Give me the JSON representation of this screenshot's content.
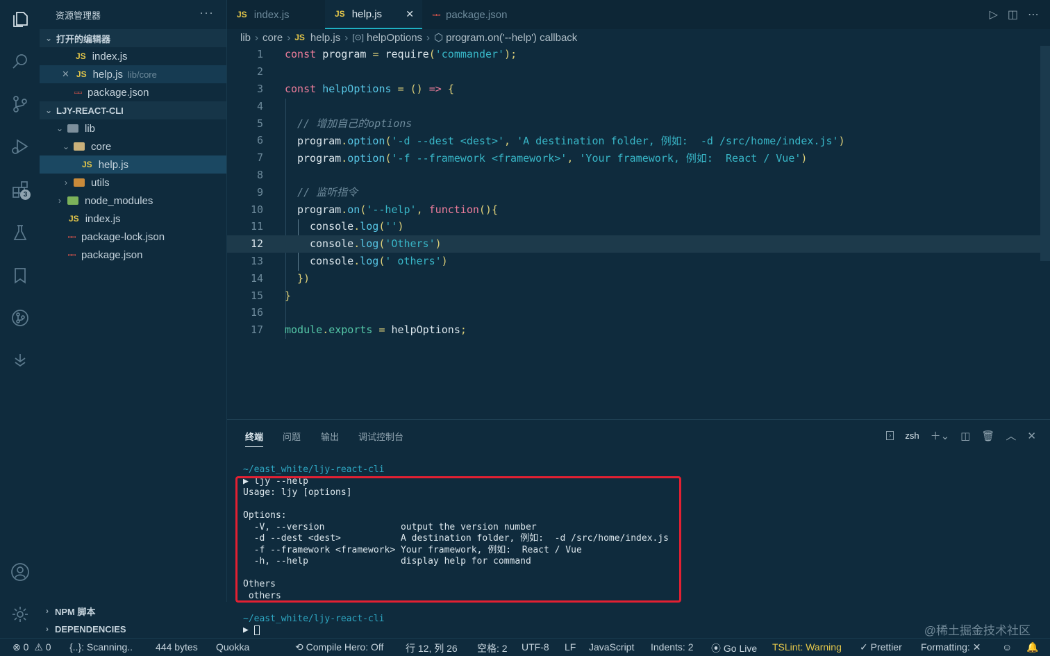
{
  "activity_bar": {
    "extensions_badge": "3"
  },
  "sidebar": {
    "title": "资源管理器",
    "more": "···",
    "open_editors": {
      "label": "打开的编辑器",
      "items": [
        {
          "icon": "JS",
          "name": "index.js",
          "path": ""
        },
        {
          "icon": "JS",
          "name": "help.js",
          "path": "lib/core"
        },
        {
          "icon": "json",
          "name": "package.json",
          "path": ""
        }
      ]
    },
    "project": {
      "label": "LJY-REACT-CLI",
      "tree": [
        {
          "name": "lib"
        },
        {
          "name": "core"
        },
        {
          "name": "help.js"
        },
        {
          "name": "utils"
        },
        {
          "name": "node_modules"
        },
        {
          "name": "index.js"
        },
        {
          "name": "package-lock.json"
        },
        {
          "name": "package.json"
        }
      ]
    },
    "npm_scripts": "NPM 脚本",
    "dependencies": "DEPENDENCIES"
  },
  "tabs": [
    {
      "icon": "JS",
      "label": "index.js"
    },
    {
      "icon": "JS",
      "label": "help.js",
      "close": "✕"
    },
    {
      "icon": "json",
      "label": "package.json"
    }
  ],
  "breadcrumb": [
    "lib",
    "core",
    "help.js",
    "helpOptions",
    "program.on('--help') callback"
  ],
  "editor": {
    "line_numbers": [
      "1",
      "2",
      "3",
      "4",
      "5",
      "6",
      "7",
      "8",
      "9",
      "10",
      "11",
      "12",
      "13",
      "14",
      "15",
      "16",
      "17"
    ],
    "current_line": "12"
  },
  "panel": {
    "tabs": [
      "终端",
      "问题",
      "输出",
      "调试控制台"
    ],
    "shell": "zsh",
    "terminal": {
      "path1": "~/east_white/ljy-react-cli",
      "cmd": "▶ ljy --help",
      "usage": "Usage: ljy [options]",
      "options_header": "Options:",
      "options": [
        {
          "flag": "  -V, --version              ",
          "desc": "output the version number"
        },
        {
          "flag": "  -d --dest <dest>           ",
          "desc": "A destination folder, 例如:  -d /src/home/index.js"
        },
        {
          "flag": "  -f --framework <framework> ",
          "desc": "Your framework, 例如:  React / Vue"
        },
        {
          "flag": "  -h, --help                 ",
          "desc": "display help for command"
        }
      ],
      "out1": "Others",
      "out2": " others",
      "path2": "~/east_white/ljy-react-cli",
      "prompt": "▶"
    }
  },
  "statusbar": {
    "errors": "0",
    "warnings": "0",
    "scanning": "{..}: Scanning..",
    "size": "444 bytes",
    "quokka": "Quokka",
    "compile_hero": "Compile Hero: Off",
    "position": "行 12, 列 26",
    "spaces": "空格: 2",
    "encoding": "UTF-8",
    "eol": "LF",
    "language": "JavaScript",
    "indents": "Indents: 2",
    "golive": "Go Live",
    "tslint": "TSLint: Warning",
    "prettier": "Prettier",
    "formatting": "Formatting: ✕"
  },
  "watermark": "@稀土掘金技术社区"
}
